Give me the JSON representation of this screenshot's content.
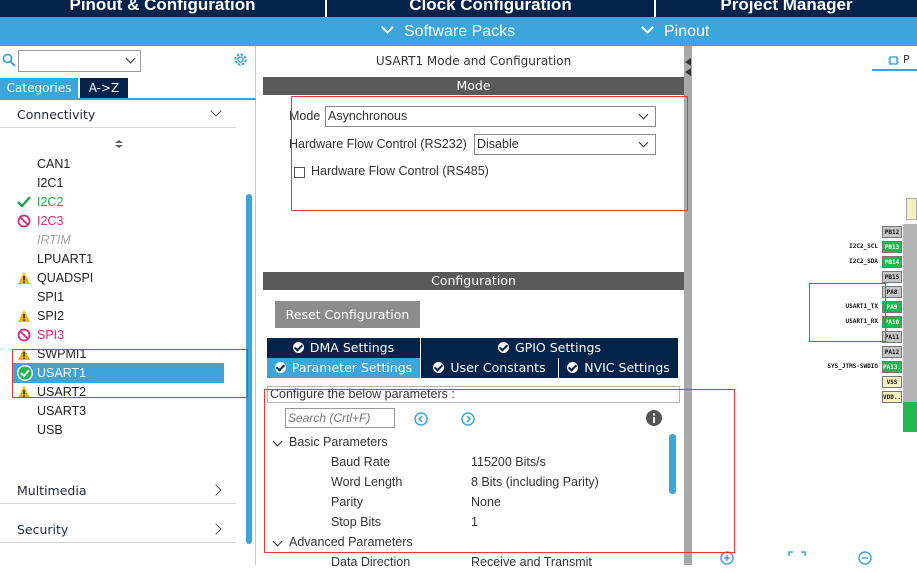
{
  "top_tabs": [
    "Pinout & Configuration",
    "Clock Configuration",
    "Project Manager"
  ],
  "sub_bar": {
    "software_packs": "Software Packs",
    "pinout": "Pinout"
  },
  "left": {
    "category_tabs": [
      "Categories",
      "A->Z"
    ],
    "sections": {
      "connectivity": "Connectivity",
      "multimedia": "Multimedia",
      "security": "Security"
    },
    "peripherals": [
      {
        "name": "CAN1",
        "status": "none"
      },
      {
        "name": "I2C1",
        "status": "none"
      },
      {
        "name": "I2C2",
        "status": "ok"
      },
      {
        "name": "I2C3",
        "status": "blocked"
      },
      {
        "name": "IRTIM",
        "status": "disabled"
      },
      {
        "name": "LPUART1",
        "status": "none"
      },
      {
        "name": "QUADSPI",
        "status": "warning"
      },
      {
        "name": "SPI1",
        "status": "none"
      },
      {
        "name": "SPI2",
        "status": "warning"
      },
      {
        "name": "SPI3",
        "status": "blocked"
      },
      {
        "name": "SWPMI1",
        "status": "warning"
      },
      {
        "name": "USART1",
        "status": "selected"
      },
      {
        "name": "USART2",
        "status": "warning"
      },
      {
        "name": "USART3",
        "status": "none"
      },
      {
        "name": "USB",
        "status": "none"
      }
    ]
  },
  "middle": {
    "title": "USART1 Mode and Configuration",
    "mode_header": "Mode",
    "mode_label": "Mode",
    "mode_value": "Asynchronous",
    "hw_flow_232_label": "Hardware Flow Control (RS232)",
    "hw_flow_232_value": "Disable",
    "hw_flow_485_label": "Hardware Flow Control (RS485)",
    "config_header": "Configuration",
    "reset_button": "Reset Configuration",
    "tabs_row1": [
      "DMA Settings",
      "GPIO Settings"
    ],
    "tabs_row2": [
      "Parameter Settings",
      "User Constants",
      "NVIC Settings"
    ],
    "configure_hint": "Configure the below parameters :",
    "search_placeholder": "Search (Crtl+F)",
    "groups": {
      "basic": "Basic Parameters",
      "advanced": "Advanced Parameters"
    },
    "basic_params": [
      {
        "name": "Baud Rate",
        "value": "115200 Bits/s"
      },
      {
        "name": "Word Length",
        "value": "8 Bits (including Parity)"
      },
      {
        "name": "Parity",
        "value": "None"
      },
      {
        "name": "Stop Bits",
        "value": "1"
      }
    ],
    "advanced_params": [
      {
        "name": "Data Direction",
        "value": "Receive and Transmit"
      }
    ]
  },
  "right": {
    "tab_label": "P",
    "pins": [
      {
        "label": "PB12",
        "signal": "",
        "color": "gray"
      },
      {
        "label": "PB13",
        "signal": "I2C2_SCL",
        "color": "green"
      },
      {
        "label": "PB14",
        "signal": "I2C2_SDA",
        "color": "green"
      },
      {
        "label": "PB15",
        "signal": "",
        "color": "gray"
      },
      {
        "label": "PA8",
        "signal": "",
        "color": "gray"
      },
      {
        "label": "PA9",
        "signal": "USART1_TX",
        "color": "green"
      },
      {
        "label": "PA10",
        "signal": "USART1_RX",
        "color": "green"
      },
      {
        "label": "PA11",
        "signal": "",
        "color": "gray"
      },
      {
        "label": "PA12",
        "signal": "",
        "color": "gray"
      },
      {
        "label": "PA13..",
        "signal": "SYS_JTMS-SWDIO",
        "color": "green"
      },
      {
        "label": "VSS",
        "signal": "",
        "color": "yellow"
      },
      {
        "label": "VDD..",
        "signal": "",
        "color": "yellow"
      }
    ]
  },
  "colors": {
    "navy": "#03234b",
    "accent": "#3ca5dc",
    "ok": "#22a046",
    "blocked": "#d62c7a",
    "warning": "#f0b400",
    "highlight": "#e03a3a"
  }
}
